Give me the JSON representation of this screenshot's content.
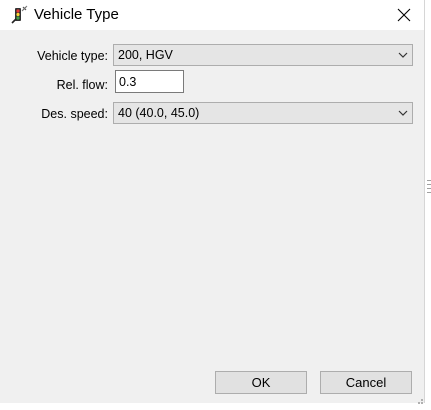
{
  "window": {
    "title": "Vehicle Type",
    "icon": "traffic-light-vehicle-icon",
    "close_icon": "close-icon"
  },
  "form": {
    "vehicle_type": {
      "label": "Vehicle type:",
      "value": "200, HGV"
    },
    "rel_flow": {
      "label": "Rel. flow:",
      "value": "0.3"
    },
    "des_speed": {
      "label": "Des. speed:",
      "value": "40 (40.0, 45.0)"
    }
  },
  "buttons": {
    "ok_label": "OK",
    "cancel_label": "Cancel"
  },
  "colors": {
    "client_bg": "#f0f0f0",
    "combo_bg": "#e5e5e5",
    "button_bg": "#e1e1e1",
    "border": "#adadad"
  }
}
